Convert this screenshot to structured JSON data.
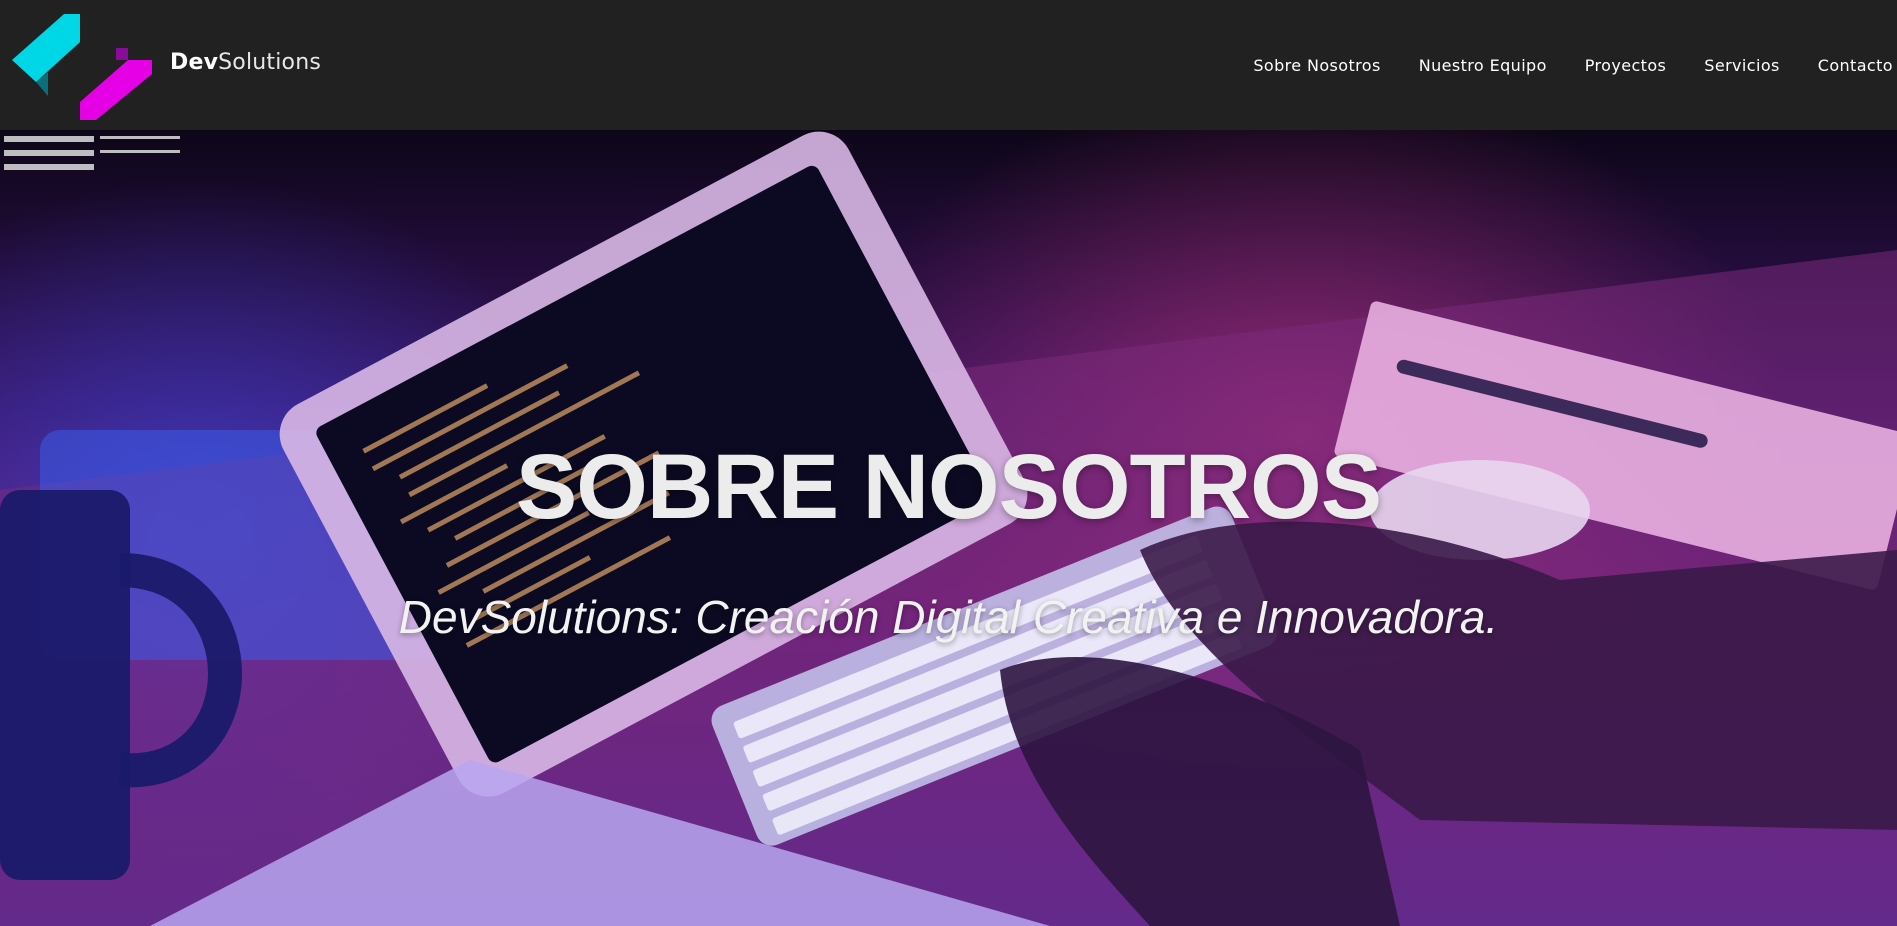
{
  "header": {
    "brand_bold": "Dev",
    "brand_light": "Solutions",
    "nav": [
      {
        "label": "Sobre Nosotros"
      },
      {
        "label": "Nuestro Equipo"
      },
      {
        "label": "Proyectos"
      },
      {
        "label": "Servicios"
      },
      {
        "label": "Contacto"
      }
    ]
  },
  "hero": {
    "title": "SOBRE NOSOTROS",
    "subtitle": "DevSolutions: Creación Digital Creativa e Innovadora."
  },
  "colors": {
    "header_bg": "#212121",
    "logo_cyan": "#00d7e6",
    "logo_magenta": "#e600e6"
  }
}
